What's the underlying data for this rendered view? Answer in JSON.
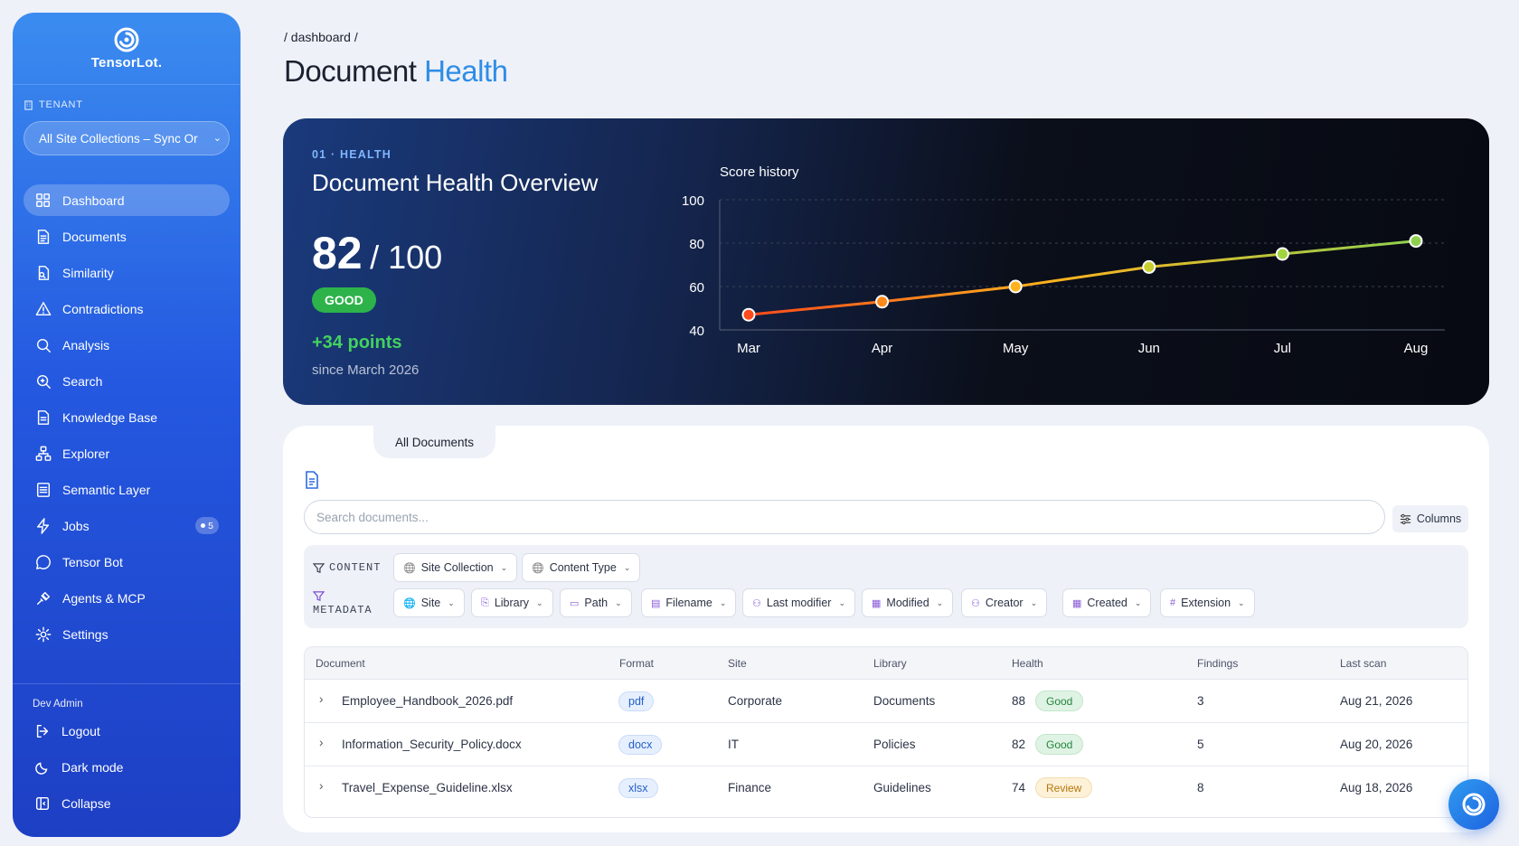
{
  "brand": {
    "name": "TensorLot."
  },
  "tenant": {
    "label": "TENANT",
    "value": "All Site Collections – Sync Or"
  },
  "nav": [
    {
      "label": "Dashboard",
      "icon": "grid-icon",
      "active": true
    },
    {
      "label": "Documents",
      "icon": "document-icon"
    },
    {
      "label": "Similarity",
      "icon": "similarity-icon"
    },
    {
      "label": "Contradictions",
      "icon": "warning-icon"
    },
    {
      "label": "Analysis",
      "icon": "search-icon"
    },
    {
      "label": "Search",
      "icon": "zoom-icon"
    },
    {
      "label": "Knowledge Base",
      "icon": "book-icon"
    },
    {
      "label": "Explorer",
      "icon": "network-icon"
    },
    {
      "label": "Semantic Layer",
      "icon": "layers-icon"
    },
    {
      "label": "Jobs",
      "icon": "bolt-icon",
      "badge": "5"
    },
    {
      "label": "Tensor Bot",
      "icon": "chat-icon"
    },
    {
      "label": "Agents & MCP",
      "icon": "plug-icon"
    },
    {
      "label": "Settings",
      "icon": "gear-icon"
    }
  ],
  "footer": {
    "user": "Dev Admin",
    "items": [
      {
        "label": "Logout",
        "icon": "logout-icon"
      },
      {
        "label": "Dark mode",
        "icon": "moon-icon"
      },
      {
        "label": "Collapse",
        "icon": "collapse-icon"
      }
    ]
  },
  "breadcrumb": "/ dashboard /",
  "page_title": {
    "main": "Document",
    "accent": "Health"
  },
  "hero": {
    "kicker": "01 · HEALTH",
    "title": "Document Health Overview",
    "score": "82",
    "score_of": "/ 100",
    "status": "GOOD",
    "delta": "+34 points",
    "since": "since March 2026"
  },
  "chart_data": {
    "type": "line",
    "title": "Score history",
    "categories": [
      "Mar",
      "Apr",
      "May",
      "Jun",
      "Jul",
      "Aug"
    ],
    "series": [
      {
        "values": [
          47,
          53,
          60,
          69,
          75,
          81
        ]
      }
    ],
    "ylim": [
      40,
      100
    ],
    "yticks": [
      40,
      60,
      80,
      100
    ],
    "grid": true,
    "colors": {
      "start": "#ff4a1c",
      "mid": "#ffb21e",
      "end": "#8fd14f"
    }
  },
  "panel": {
    "tab": "All Documents",
    "search_placeholder": "Search documents...",
    "columns_label": "Columns"
  },
  "filters": {
    "content_label": "CONTENT",
    "content": [
      "Site Collection",
      "Content Type"
    ],
    "metadata_label": "METADATA",
    "metadata": [
      "Site",
      "Library",
      "Path",
      "Filename",
      "Last modifier",
      "Modified",
      "Creator",
      "Created",
      "Extension"
    ]
  },
  "table": {
    "headers": [
      "Document",
      "Format",
      "Site",
      "Library",
      "Health",
      "Findings",
      "Last scan"
    ],
    "rows": [
      {
        "document": "Employee_Handbook_2026.pdf",
        "format": "pdf",
        "site": "Corporate",
        "library": "Documents",
        "health": "88",
        "status": "Good",
        "findings": "3",
        "last_scan": "Aug 21, 2026"
      },
      {
        "document": "Information_Security_Policy.docx",
        "format": "docx",
        "site": "IT",
        "library": "Policies",
        "health": "82",
        "status": "Good",
        "findings": "5",
        "last_scan": "Aug 20, 2026"
      },
      {
        "document": "Travel_Expense_Guideline.xlsx",
        "format": "xlsx",
        "site": "Finance",
        "library": "Guidelines",
        "health": "74",
        "status": "Review",
        "findings": "8",
        "last_scan": "Aug 18, 2026"
      }
    ]
  }
}
